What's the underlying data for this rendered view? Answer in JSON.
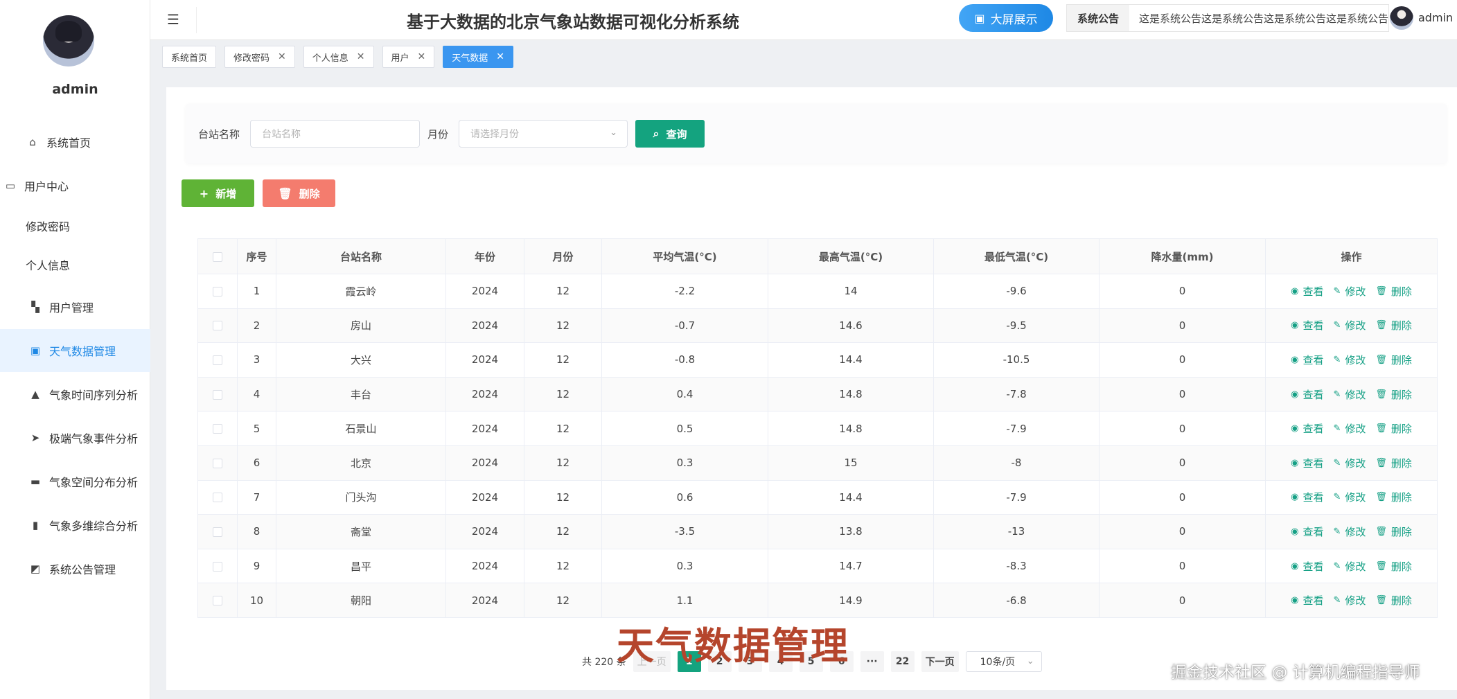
{
  "sidebar": {
    "username": "admin",
    "items": [
      {
        "label": "系统首页",
        "icon": "home-icon",
        "glyph": "⌂"
      },
      {
        "label": "用户中心",
        "icon": "window-icon",
        "glyph": "▭"
      },
      {
        "label": "修改密码",
        "icon": "",
        "glyph": ""
      },
      {
        "label": "个人信息",
        "icon": "",
        "glyph": ""
      },
      {
        "label": "用户管理",
        "icon": "id-card-icon",
        "glyph": "▚"
      },
      {
        "label": "天气数据管理",
        "icon": "clipboard-icon",
        "glyph": "▣"
      },
      {
        "label": "气象时间序列分析",
        "icon": "person-icon",
        "glyph": "▲"
      },
      {
        "label": "极端气象事件分析",
        "icon": "send-icon",
        "glyph": "➤"
      },
      {
        "label": "气象空间分布分析",
        "icon": "chat-icon",
        "glyph": "▬"
      },
      {
        "label": "气象多维综合分析",
        "icon": "bar-chart-icon",
        "glyph": "▮"
      },
      {
        "label": "系统公告管理",
        "icon": "line-chart-icon",
        "glyph": "◩"
      }
    ]
  },
  "header": {
    "title": "基于大数据的北京气象站数据可视化分析系统",
    "bigscreen_label": "大屏展示",
    "notice_label": "系统公告",
    "notice_text": "这是系统公告这是系统公告这是系统公告这是系统公告",
    "username": "admin"
  },
  "tabs": [
    {
      "label": "系统首页",
      "closable": false
    },
    {
      "label": "修改密码",
      "closable": true
    },
    {
      "label": "个人信息",
      "closable": true
    },
    {
      "label": "用户",
      "closable": true
    },
    {
      "label": "天气数据",
      "closable": true,
      "active": true
    }
  ],
  "search": {
    "station_label": "台站名称",
    "station_placeholder": "台站名称",
    "month_label": "月份",
    "month_placeholder": "请选择月份",
    "search_button": "查询"
  },
  "actions": {
    "add_button": "新增",
    "delete_button": "删除"
  },
  "table": {
    "headers": [
      "序号",
      "台站名称",
      "年份",
      "月份",
      "平均气温(°C)",
      "最高气温(°C)",
      "最低气温(°C)",
      "降水量(mm)",
      "操作"
    ],
    "op_view": "查看",
    "op_edit": "修改",
    "op_delete": "删除",
    "rows": [
      [
        "1",
        "霞云岭",
        "2024",
        "12",
        "-2.2",
        "14",
        "-9.6",
        "0"
      ],
      [
        "2",
        "房山",
        "2024",
        "12",
        "-0.7",
        "14.6",
        "-9.5",
        "0"
      ],
      [
        "3",
        "大兴",
        "2024",
        "12",
        "-0.8",
        "14.4",
        "-10.5",
        "0"
      ],
      [
        "4",
        "丰台",
        "2024",
        "12",
        "0.4",
        "14.8",
        "-7.8",
        "0"
      ],
      [
        "5",
        "石景山",
        "2024",
        "12",
        "0.5",
        "14.8",
        "-7.9",
        "0"
      ],
      [
        "6",
        "北京",
        "2024",
        "12",
        "0.3",
        "15",
        "-8",
        "0"
      ],
      [
        "7",
        "门头沟",
        "2024",
        "12",
        "0.6",
        "14.4",
        "-7.9",
        "0"
      ],
      [
        "8",
        "斋堂",
        "2024",
        "12",
        "-3.5",
        "13.8",
        "-13",
        "0"
      ],
      [
        "9",
        "昌平",
        "2024",
        "12",
        "0.3",
        "14.7",
        "-8.3",
        "0"
      ],
      [
        "10",
        "朝阳",
        "2024",
        "12",
        "1.1",
        "14.9",
        "-6.8",
        "0"
      ]
    ]
  },
  "pagination": {
    "total": "共 220 条",
    "prev": "上一页",
    "pages": [
      "1",
      "2",
      "3",
      "4",
      "5",
      "6",
      "···",
      "22"
    ],
    "current": "1",
    "next": "下一页",
    "page_size": "10条/页"
  },
  "overlay_caption": "天气数据管理",
  "watermark": "掘金技术社区 @ 计算机编程指导师",
  "colors": {
    "primary": "#1e88e5",
    "teal": "#14a37f",
    "green": "#5fb336",
    "red": "#f47c6e",
    "active_tab": "#3a96f0"
  }
}
